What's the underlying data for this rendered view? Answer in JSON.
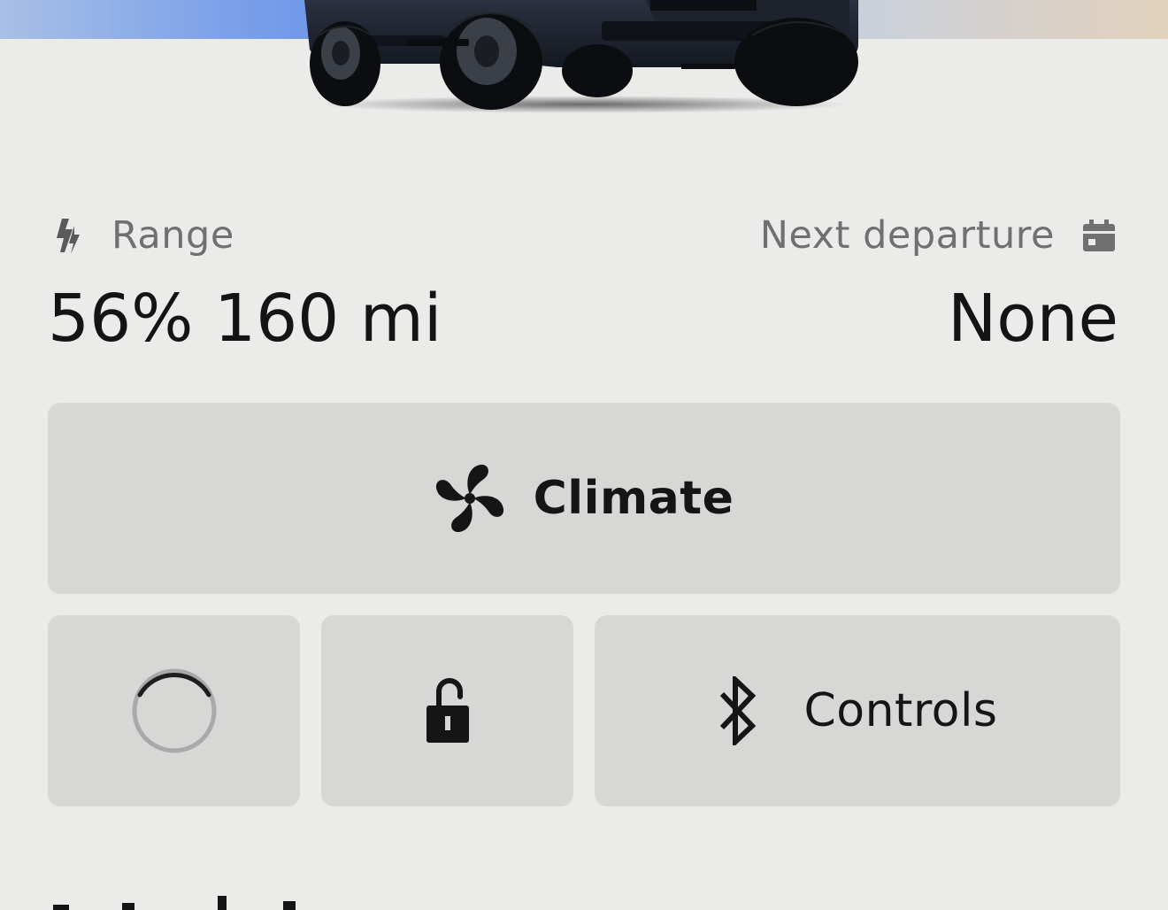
{
  "stats": {
    "range_label": "Range",
    "range_value": "56% 160 mi",
    "departure_label": "Next departure",
    "departure_value": "None"
  },
  "actions": {
    "climate_label": "Climate",
    "controls_label": "Controls"
  },
  "icons": {
    "range": "bolt-icon",
    "departure": "calendar-icon",
    "climate": "fan-icon",
    "status": "loading-spinner-icon",
    "lock": "unlocked-padlock-icon",
    "controls": "bluetooth-icon"
  },
  "colors": {
    "background": "#ebebea",
    "tile": "#d7d7d6",
    "text_primary": "#151515",
    "text_secondary": "#707070",
    "hero_blue": "#6f97ea"
  }
}
